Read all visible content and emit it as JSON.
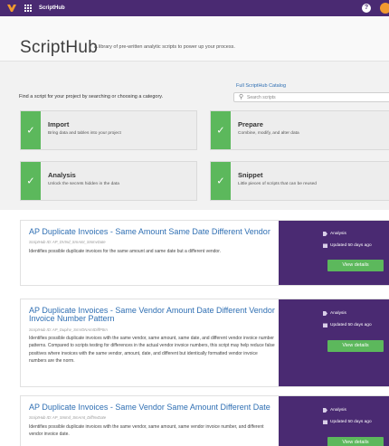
{
  "topbar": {
    "app_name": "ScriptHub",
    "help_icon": "?",
    "logo_color": "#f19a2f",
    "bar_color": "#4a2a72"
  },
  "header": {
    "title": "ScriptHub",
    "subtitle": "A library of pre-written analytic scripts to power up your process."
  },
  "finder": {
    "prompt": "Find a script for your project by searching or choosing a category.",
    "catalog_link": "Full ScriptHub Catalog",
    "search_placeholder": "Search scripts"
  },
  "categories": [
    {
      "name": "Import",
      "description": "Bring data and tables into your project"
    },
    {
      "name": "Prepare",
      "description": "Combine, modify, and alter data"
    },
    {
      "name": "Analysis",
      "description": "Unlock the secrets hidden in the data"
    },
    {
      "name": "Snippet",
      "description": "Little pieces of scripts that can be reused"
    }
  ],
  "results": [
    {
      "title": "AP Duplicate Invoices - Same Amount Same Date Different Vendor",
      "id": "ScriptHub ID: AP_DVInd_SmAmt_SmInvDate",
      "description": "Identifies possible duplicate invoices for the same amount and same date but a different vendor.",
      "category": "Analysis",
      "updated": "Updated 50 days ago",
      "button": "View details"
    },
    {
      "title": "AP Duplicate Invoices - Same Vendor Amount Date Different Vendor Invoice Number Pattern",
      "id": "ScriptHub ID: AP_Duplnv_SmVDNAmtDiffPttrn",
      "description": "Identifies possible duplicate invoices with the same vendor, same amount, same date, and different vendor invoice number patterns. Compared to scripts testing for differences in the actual vendor invoice numbers, this script may help reduce false positives where invoices with the same vendor, amount, date, and different but identically formatted vendor invoice numbers are the norm.",
      "category": "Analysis",
      "updated": "Updated 50 days ago",
      "button": "View details"
    },
    {
      "title": "AP Duplicate Invoices - Same Vendor Same Amount Different Date",
      "id": "ScriptHub ID: AP_SmInd_SmAmt_DiffInvDate",
      "description": "Identifies possible duplicate invoices with the same vendor, same amount, same vendor invoice number, and different vendor invoice date.",
      "category": "Analysis",
      "updated": "Updated 50 days ago",
      "button": "View details"
    }
  ]
}
